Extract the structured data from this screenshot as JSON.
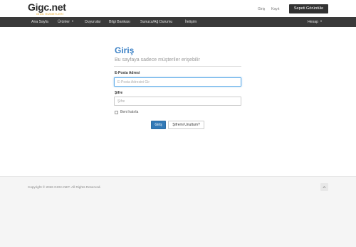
{
  "header": {
    "logo_text": "Gigc.net",
    "logo_subtext": "GIGC HIZMETLERI",
    "login_link": "Giriş",
    "register_link": "Kayıt",
    "cart_button": "Sepeti Görüntüle"
  },
  "navbar": {
    "items": [
      {
        "label": "Ana Sayfa"
      },
      {
        "label": "Ürünler"
      },
      {
        "label": "Duyurular"
      },
      {
        "label": "Bilgi Bankası"
      },
      {
        "label": "Sunucu/Ağ Durumu"
      },
      {
        "label": "İletişim"
      }
    ],
    "account": "Hesap"
  },
  "login": {
    "title": "Giriş",
    "subtitle": "Bu sayfaya sadece müşteriler erişebilir",
    "email_label": "E-Posta Adresi",
    "email_placeholder": "E-Posta Adresini Gir",
    "email_value": "",
    "password_label": "Şifre",
    "password_placeholder": "Şifre",
    "password_value": "",
    "remember_label": "Beni hatırla",
    "remember_checked": false,
    "login_button": "Giriş",
    "forgot_button": "Şifremi Unuttum?"
  },
  "footer": {
    "copyright": "Copyright © 2026 GIGC.NET. All Rights Reserved."
  },
  "colors": {
    "navbar_bg": "#3a3a3a",
    "accent": "#3d82c6",
    "primary_button": "#337ab7",
    "cart_button_bg": "#333333",
    "logo_accent": "#e8a317"
  }
}
